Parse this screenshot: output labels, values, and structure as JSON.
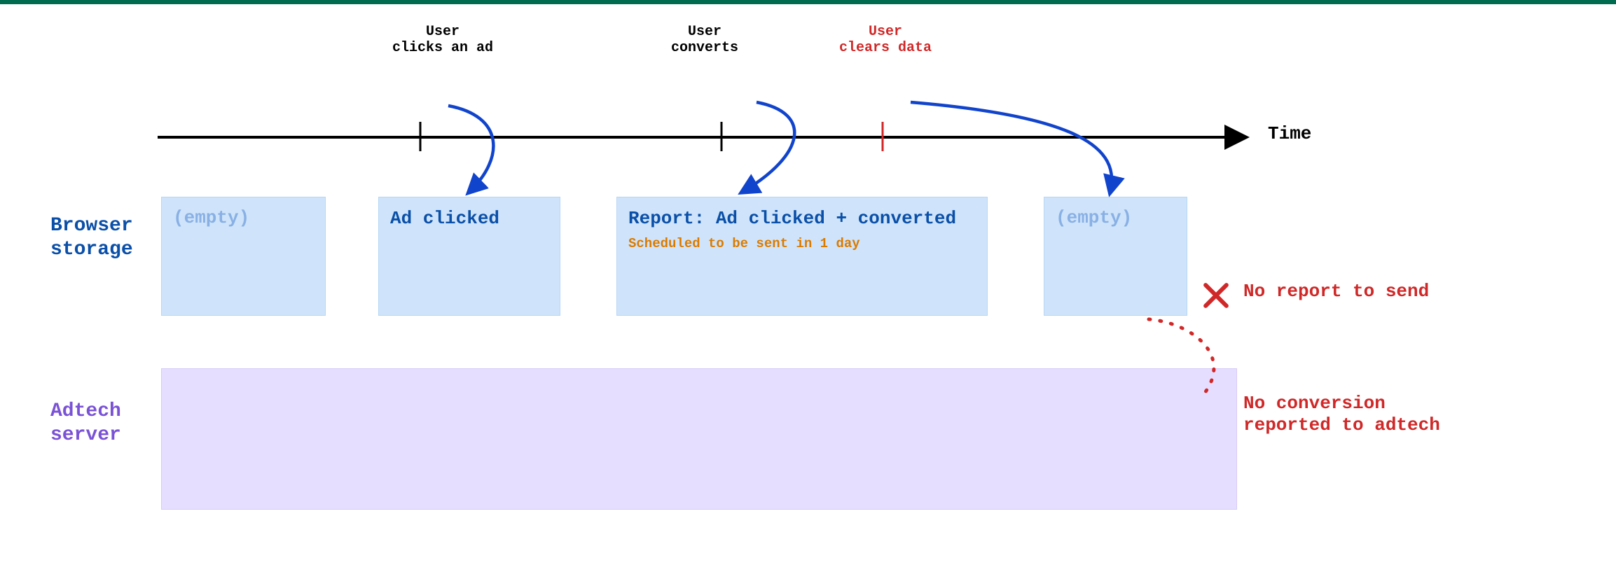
{
  "axis": {
    "time_label": "Time"
  },
  "events": {
    "click": "User\nclicks an ad",
    "convert": "User\nconverts",
    "clear": "User\nclears data"
  },
  "layers": {
    "browser": "Browser\nstorage",
    "server": "Adtech\nserver"
  },
  "boxes": {
    "empty1": "(empty)",
    "clicked": "Ad clicked",
    "report_title": "Report:\nAd clicked + converted",
    "report_sched": "Scheduled to be sent in 1 day",
    "empty2": "(empty)"
  },
  "annotations": {
    "no_report": "No report to send",
    "no_conv": "No conversion\nreported to adtech"
  }
}
